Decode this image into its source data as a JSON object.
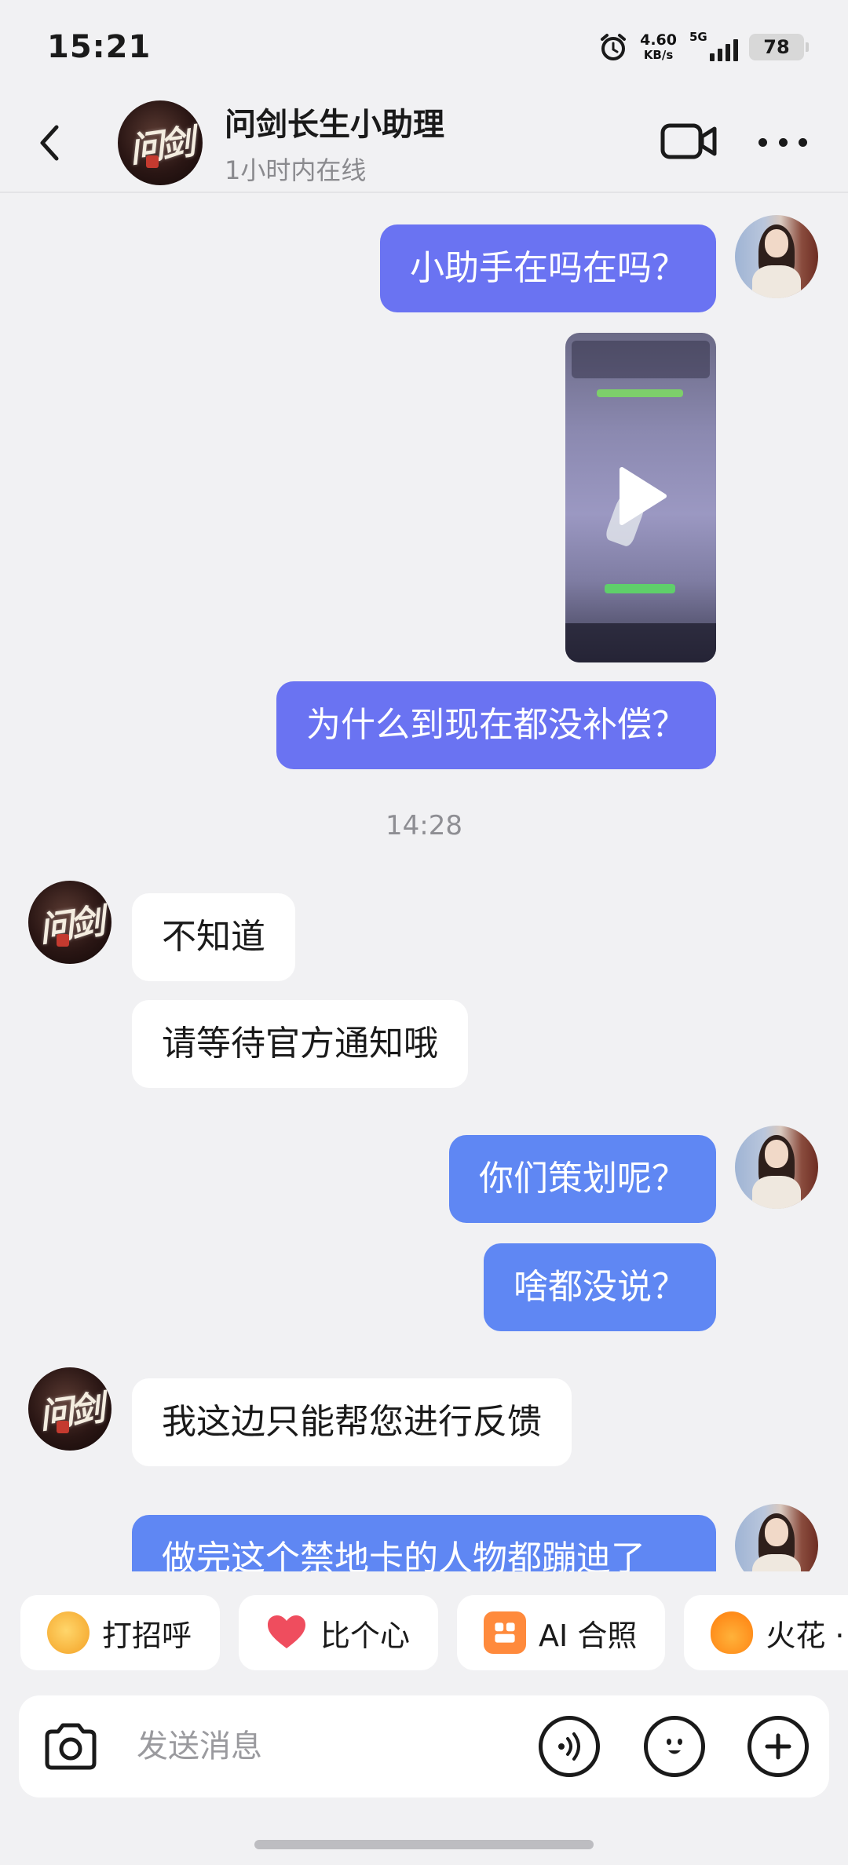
{
  "status_bar": {
    "time": "15:21",
    "net_speed": "4.60",
    "net_unit": "KB/s",
    "network": "5G",
    "battery": "78",
    "icons": [
      "alarm-icon",
      "signal-icon",
      "battery-icon"
    ]
  },
  "header": {
    "contact_name": "问剑长生小助理",
    "contact_status": "1小时内在线",
    "avatar_text": "问剑",
    "icons": [
      "back-arrow-icon",
      "video-call-icon",
      "more-icon"
    ]
  },
  "messages": [
    {
      "side": "out",
      "text": "小助手在吗在吗？"
    },
    {
      "side": "out",
      "type": "video",
      "icon": "play-icon"
    },
    {
      "side": "out",
      "text": "为什么到现在都没补偿？"
    },
    {
      "type": "time",
      "text": "14:28"
    },
    {
      "side": "in",
      "text": "不知道"
    },
    {
      "side": "in",
      "text": "请等待官方通知哦"
    },
    {
      "side": "out",
      "text": "你们策划呢？"
    },
    {
      "side": "out",
      "text": "啥都没说？"
    },
    {
      "side": "in",
      "text": "我这边只能帮您进行反馈"
    },
    {
      "side": "out",
      "text": "做完这个禁地卡的人物都蹦迪了"
    }
  ],
  "quick_replies": [
    {
      "label": "打招呼",
      "icon": "wave-emoji-icon"
    },
    {
      "label": "比个心",
      "icon": "heart-icon"
    },
    {
      "label": "AI 合照",
      "icon": "ai-photo-icon"
    },
    {
      "label": "火花 ·",
      "icon": "spark-icon"
    }
  ],
  "input": {
    "placeholder": "发送消息",
    "icons": [
      "camera-icon",
      "voice-icon",
      "emoji-icon",
      "plus-icon"
    ]
  },
  "colors": {
    "out_bubble": "#6a73f2",
    "out_bubble_alt": "#5f87f3",
    "in_bubble": "#ffffff",
    "background": "#f1f1f3"
  }
}
